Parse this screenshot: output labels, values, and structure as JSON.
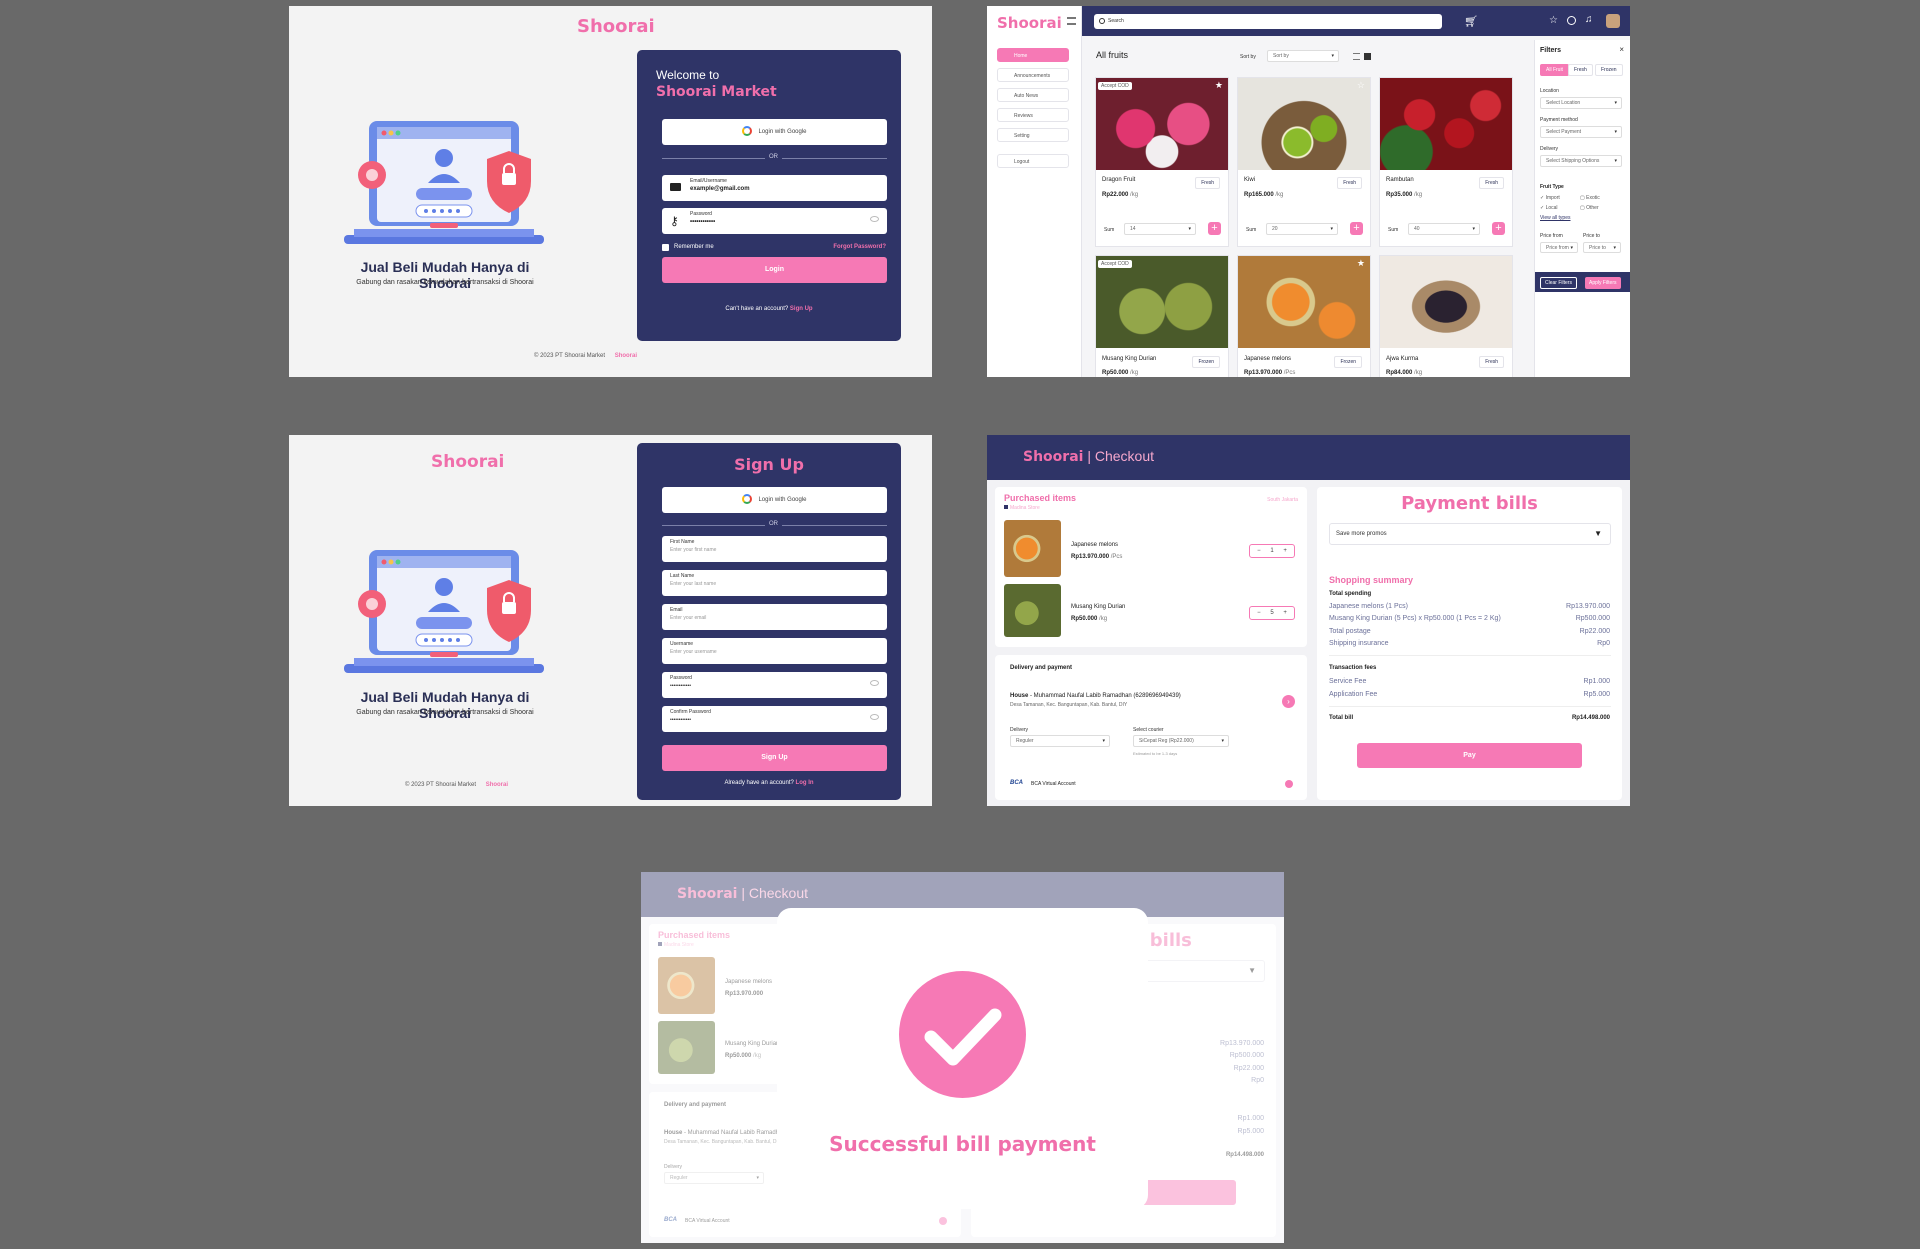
{
  "brand": "Shoorai",
  "login": {
    "headline": "Jual Beli Mudah Hanya di Shoorai",
    "subheadline": "Gabung dan rasakan kemudahan bertransaksi di Shoorai",
    "welcome": "Welcome to",
    "market": "Shoorai Market",
    "google": "Login with Google",
    "or": "OR",
    "email_label": "Email/Username",
    "email_value": "example@gmail.com",
    "password_label": "Password",
    "password_value": "••••••••••••",
    "remember": "Remember me",
    "forgot": "Forgot Password?",
    "login_button": "Login",
    "no_account": "Can't have an account?",
    "signup_link": "Sign Up",
    "footer": "© 2023 PT Shoorai Market",
    "footer_brand": "Shoorai"
  },
  "catalog": {
    "search_placeholder": "Search",
    "title": "All fruits",
    "sort_label": "Sort by",
    "sort_value": "Sort by",
    "sidebar": [
      "Home",
      "Announcements",
      "Auto News",
      "Reviews",
      "Setting",
      "Logout"
    ],
    "filters": {
      "title": "Filters",
      "tabs": [
        "All Fruit",
        "Fresh",
        "Frozen"
      ],
      "location_label": "Location",
      "location_value": "Select Location",
      "payment_label": "Payment method",
      "payment_value": "Select Payment",
      "delivery_label": "Delivery",
      "delivery_value": "Select Shipping Options",
      "fruit_type_label": "Fruit Type",
      "fruit_types": [
        "Import",
        "Exotic",
        "Local",
        "Other"
      ],
      "view_all": "View all types",
      "price_from_label": "Price from",
      "price_to_label": "Price to",
      "price_from_ph": "Price from",
      "price_to_ph": "Price to",
      "clear": "Clear Filters",
      "apply": "Apply Filters"
    },
    "products": [
      {
        "name": "Dragon Fruit",
        "tag": "Fresh",
        "price": "Rp22.000",
        "unit": "/kg",
        "sum_label": "Sum",
        "sum": "14",
        "badge": "Accept COD"
      },
      {
        "name": "Kiwi",
        "tag": "Fresh",
        "price": "Rp165.000",
        "unit": "/kg",
        "sum_label": "Sum",
        "sum": "20",
        "badge": ""
      },
      {
        "name": "Rambutan",
        "tag": "Fresh",
        "price": "Rp35.000",
        "unit": "/kg",
        "sum_label": "Sum",
        "sum": "40",
        "badge": ""
      },
      {
        "name": "Musang King Durian",
        "tag": "Frozen",
        "price": "Rp50.000",
        "unit": "/kg",
        "badge": "Accept COD"
      },
      {
        "name": "Japanese melons",
        "tag": "Frozen",
        "price": "Rp13.970.000",
        "unit": "/Pcs",
        "badge": ""
      },
      {
        "name": "Ajwa Kurma",
        "tag": "Fresh",
        "price": "Rp84.000",
        "unit": "/kg",
        "badge": ""
      }
    ]
  },
  "signup": {
    "title": "Sign Up",
    "google": "Login with Google",
    "or": "OR",
    "fields": [
      {
        "label": "First Name",
        "placeholder": "Enter your first name"
      },
      {
        "label": "Last Name",
        "placeholder": "Enter your last name"
      },
      {
        "label": "Email",
        "placeholder": "Enter your email"
      },
      {
        "label": "Username",
        "placeholder": "Enter your username"
      },
      {
        "label": "Password",
        "placeholder": "••••••••••••"
      },
      {
        "label": "Confirm Password",
        "placeholder": "••••••••••••"
      }
    ],
    "button": "Sign Up",
    "have_account": "Already have an account?",
    "login_link": "Log In",
    "footer": "© 2023 PT Shoorai Market",
    "footer_brand": "Shoorai"
  },
  "checkout": {
    "brand": "Shoorai",
    "page": "| Checkout",
    "purchased": "Purchased items",
    "store": "Madina Store",
    "location": "South Jakarta",
    "items": [
      {
        "name": "Japanese melons",
        "price": "Rp13.970.000",
        "unit": "/Pcs",
        "qty": "1"
      },
      {
        "name": "Musang King Durian",
        "price": "Rp50.000",
        "unit": "/kg",
        "qty": "5"
      }
    ],
    "delivery_title": "Delivery and payment",
    "address_label": "House",
    "address_name": "- Muhammad Naufal Labib Ramadhan (6289696949439)",
    "address_detail": "Desa Tamanan, Kec. Banguntapan, Kab. Bantul, DIY",
    "delivery_label": "Delivery",
    "delivery_value": "Reguler",
    "courier_label": "Select courier",
    "courier_value": "SiCepat Reg (Rp22.000)",
    "courier_note": "Estimated to be 1-3 days",
    "payment_method": "BCA Virtual Account",
    "bills_title": "Payment bills",
    "promo": "Save more promos",
    "summary_title": "Shopping summary",
    "total_spending": "Total spending",
    "rows": [
      {
        "label": "Japanese melons (1 Pcs)",
        "value": "Rp13.970.000"
      },
      {
        "label": "Musang King Durian (5 Pcs) x Rp50.000 (1 Pcs = 2 Kg)",
        "value": "Rp500.000"
      },
      {
        "label": "Total postage",
        "value": "Rp22.000"
      },
      {
        "label": "Shipping insurance",
        "value": "Rp0"
      }
    ],
    "fees_title": "Transaction fees",
    "fees": [
      {
        "label": "Service Fee",
        "value": "Rp1.000"
      },
      {
        "label": "Application Fee",
        "value": "Rp5.000"
      }
    ],
    "total_label": "Total bill",
    "total_value": "Rp14.498.000",
    "pay": "Pay"
  },
  "success": {
    "message": "Successful bill payment"
  },
  "colors": {
    "navy": "#2f3467",
    "pink": "#f06fab",
    "pink_button": "#f679b5",
    "background": "#696969"
  }
}
